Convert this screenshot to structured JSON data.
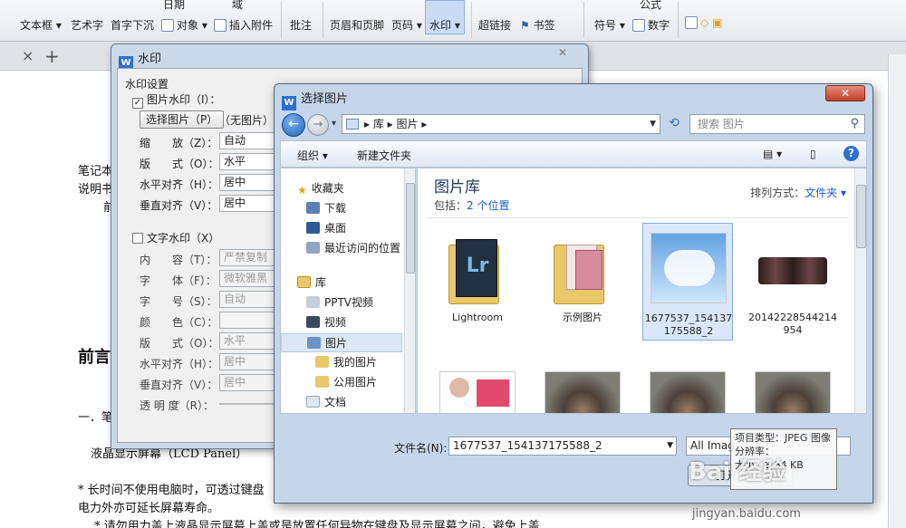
{
  "ribbon": {
    "top_row": [
      "日期",
      "域"
    ],
    "items": [
      "文本框",
      "艺术字",
      "首字下沉",
      "对象",
      "插入附件",
      "批注",
      "页眉和页脚",
      "页码",
      "水印",
      "超链接",
      "书签",
      "符号",
      "数字"
    ],
    "extra": "公式",
    "active_item": "水印"
  },
  "doc": {
    "lines": [
      "笔记本",
      "说明书",
      "前",
      "前言",
      "一．笔",
      "液晶显示屏幕（LCD Panel）",
      "* 长时间不使用电脑时，可透过键盘",
      "电力外亦可延长屏幕寿命。",
      "* 请勿用力盖上液晶显示屏幕上盖或是放置任何异物在键盘及显示屏幕之间，避免上盖"
    ]
  },
  "watermark_dialog": {
    "title": "水印",
    "close_glyph": "✕",
    "group_label": "水印设置",
    "picture": {
      "checkbox_label": "图片水印（I）：",
      "checked": true,
      "select_button": "选择图片（P）",
      "no_picture": "（无图片）",
      "rows": [
        {
          "label": "缩　　放（Z）：",
          "value": "自动"
        },
        {
          "label": "版　　式（O）：",
          "value": "水平"
        },
        {
          "label": "水平对齐（H）：",
          "value": "居中"
        },
        {
          "label": "垂直对齐（V）：",
          "value": "居中"
        }
      ]
    },
    "text": {
      "checkbox_label": "文字水印（X）",
      "checked": false,
      "rows": [
        {
          "label": "内　　容（T）：",
          "value": "严禁复制"
        },
        {
          "label": "字　　体（F）：",
          "value": "微软雅黑"
        },
        {
          "label": "字　　号（S）：",
          "value": "自动"
        },
        {
          "label": "颜　　色（C）：",
          "value": ""
        },
        {
          "label": "版　　式（O）：",
          "value": "水平"
        },
        {
          "label": "水平对齐（H）：",
          "value": "居中"
        },
        {
          "label": "垂直对齐（V）：",
          "value": "居中"
        },
        {
          "label": "透 明 度（R）：",
          "value": ""
        }
      ]
    }
  },
  "open_dialog": {
    "title": "选择图片",
    "close_glyph": "✕",
    "address": [
      "库",
      "图片"
    ],
    "search_placeholder": "搜索 图片",
    "toolbar": {
      "organize": "组织 ▾",
      "new_folder": "新建文件夹",
      "help": "?"
    },
    "nav": [
      {
        "label": "收藏夹",
        "icon": "star-icon",
        "level": 0
      },
      {
        "label": "下载",
        "icon": "download-folder-icon",
        "level": 1
      },
      {
        "label": "桌面",
        "icon": "desktop-icon",
        "level": 1
      },
      {
        "label": "最近访问的位置",
        "icon": "recent-places-icon",
        "level": 1
      },
      {
        "label": "库",
        "icon": "library-icon",
        "level": 0
      },
      {
        "label": "PPTV视频",
        "icon": "video-library-icon",
        "level": 1
      },
      {
        "label": "视频",
        "icon": "video-library-icon",
        "level": 1
      },
      {
        "label": "图片",
        "icon": "pictures-library-icon",
        "level": 1,
        "selected": true
      },
      {
        "label": "我的图片",
        "icon": "folder-icon",
        "level": 2
      },
      {
        "label": "公用图片",
        "icon": "folder-icon",
        "level": 2
      },
      {
        "label": "文档",
        "icon": "documents-library-icon",
        "level": 1
      }
    ],
    "library": {
      "title": "图片库",
      "includes_prefix": "包括：",
      "includes_link": "2 个位置",
      "arrange_label": "排列方式：",
      "arrange_value": "文件夹 ▾"
    },
    "files": [
      {
        "name": "Lightroom",
        "kind": "folder"
      },
      {
        "name": "示例图片",
        "kind": "folder"
      },
      {
        "name": "1677537_154137175588_2",
        "kind": "image",
        "selected": true
      },
      {
        "name": "20142228544214954",
        "kind": "image"
      },
      {
        "name": "",
        "kind": "image"
      },
      {
        "name": "",
        "kind": "image"
      },
      {
        "name": "",
        "kind": "image"
      },
      {
        "name": "",
        "kind": "image"
      }
    ],
    "filename_label": "文件名(N):",
    "filename_value": "1677537_154137175588_2",
    "filetype_value": "All Imag",
    "open_button": "打开",
    "tooltip": [
      "项目类型：JPEG 图像",
      "分辨率：",
      "大小：8.84 KB"
    ]
  },
  "watermark_overlay": {
    "brand": "Bai 经验",
    "url": "jingyan.baidu.com"
  }
}
